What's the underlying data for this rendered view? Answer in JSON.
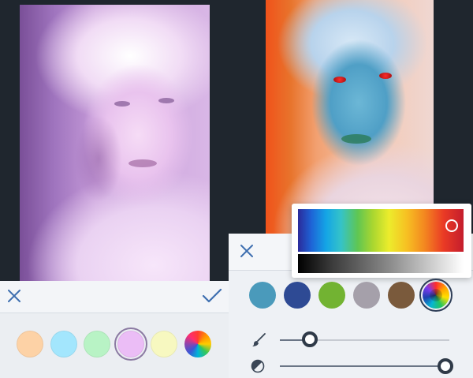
{
  "screens": [
    {
      "id": "left",
      "toolbar": {
        "close_icon": "close-icon",
        "confirm_icon": "checkmark-icon"
      },
      "palette": [
        {
          "name": "peach",
          "color": "#fdd2a6"
        },
        {
          "name": "light-blue",
          "color": "#a3e6fd"
        },
        {
          "name": "light-green",
          "color": "#b8f3c5"
        },
        {
          "name": "lavender",
          "color": "#ebbdf6",
          "selected": true
        },
        {
          "name": "pale-yellow",
          "color": "#f7f8c0"
        },
        {
          "name": "custom-color-wheel",
          "color": "rainbow"
        }
      ],
      "tint": "#d7a6e8"
    },
    {
      "id": "right",
      "toolbar": {
        "close_icon": "close-icon"
      },
      "palette": [
        {
          "name": "teal-blue",
          "color": "#4a9abb"
        },
        {
          "name": "navy",
          "color": "#2e4a94"
        },
        {
          "name": "green",
          "color": "#72b332"
        },
        {
          "name": "gray",
          "color": "#a5a0aa"
        },
        {
          "name": "brown",
          "color": "#7a5a3c"
        },
        {
          "name": "custom-color-wheel",
          "color": "rainbow",
          "selected": true
        }
      ],
      "color_picker": {
        "hue_position": 0.93,
        "gray_position": 0.0
      },
      "sliders": [
        {
          "name": "brush-size",
          "icon": "brush-icon",
          "value": 0.16
        },
        {
          "name": "opacity",
          "icon": "contrast-icon",
          "value": 1.0
        }
      ]
    }
  ],
  "colors": {
    "background": "#1f262e",
    "icon_blue": "#3e6fb0",
    "slider_knob": "#2f3a48"
  }
}
